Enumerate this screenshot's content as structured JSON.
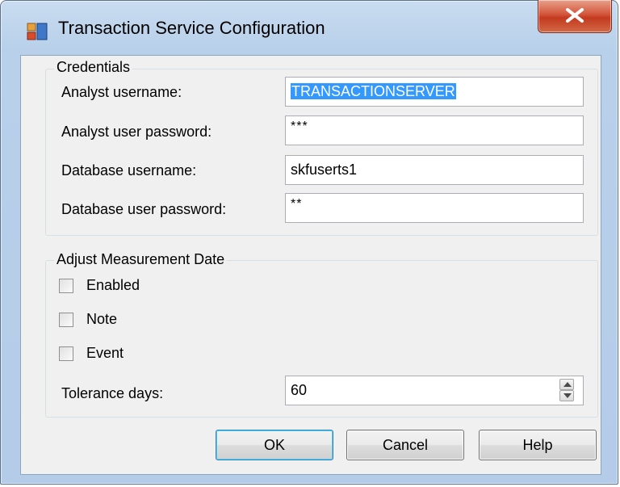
{
  "window": {
    "title": "Transaction Service Configuration",
    "icon": "app-window-icon",
    "close_icon": "close-icon"
  },
  "credentials": {
    "group_label": "Credentials",
    "analyst_username_label": "Analyst username:",
    "analyst_username_value": "TRANSACTIONSERVER",
    "analyst_password_label": "Analyst user password:",
    "analyst_password_value": "***",
    "database_username_label": "Database username:",
    "database_username_value": "skfuserts1",
    "database_password_label": "Database user password:",
    "database_password_value": "**"
  },
  "adjust": {
    "group_label": "Adjust Measurement Date",
    "enabled_label": "Enabled",
    "enabled_checked": false,
    "note_label": "Note",
    "note_checked": false,
    "event_label": "Event",
    "event_checked": false,
    "tolerance_label": "Tolerance days:",
    "tolerance_value": "60"
  },
  "buttons": {
    "ok": "OK",
    "cancel": "Cancel",
    "help": "Help"
  },
  "colors": {
    "selection": "#3399ff",
    "close_button": "#c33a1f",
    "dialog_background": "#f0f0f0"
  }
}
